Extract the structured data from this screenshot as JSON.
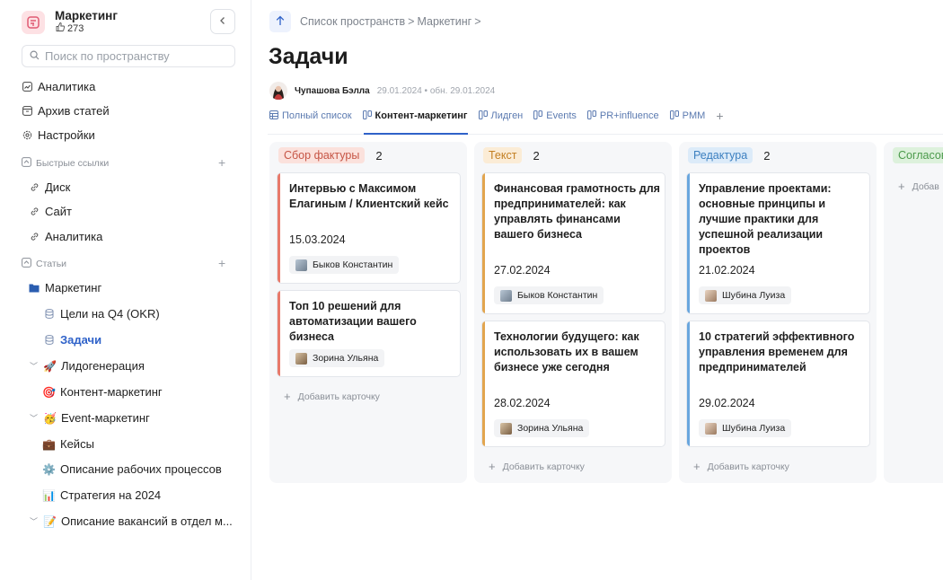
{
  "sidebar": {
    "space_name": "Маркетинг",
    "space_likes": "273",
    "search_placeholder": "Поиск по пространству",
    "top_items": [
      {
        "label": "Аналитика",
        "icon": "chart-icon"
      },
      {
        "label": "Архив статей",
        "icon": "archive-icon"
      },
      {
        "label": "Настройки",
        "icon": "gear-icon"
      }
    ],
    "quick_links_label": "Быстрые ссылки",
    "quick_links": [
      "Диск",
      "Сайт",
      "Аналитика"
    ],
    "articles_label": "Статьи",
    "tree": [
      {
        "label": "Маркетинг",
        "icon": "📁"
      },
      {
        "label": "Цели на Q4 (OKR)"
      },
      {
        "label": "Задачи"
      },
      {
        "label": "Лидогенерация",
        "icon": "🚀"
      },
      {
        "label": "Контент-маркетинг",
        "icon": "🎯"
      },
      {
        "label": "Event-маркетинг",
        "icon": "🥳"
      },
      {
        "label": "Кейсы",
        "icon": "💼"
      },
      {
        "label": "Описание рабочих процессов",
        "icon": "⚙️"
      },
      {
        "label": "Стратегия на 2024",
        "icon": "📊"
      },
      {
        "label": "Описание вакансий в отдел м...",
        "icon": "📝"
      }
    ]
  },
  "breadcrumb": {
    "spaces": "Список пространств",
    "sep1": ">",
    "space": "Маркетинг",
    "sep2": ">"
  },
  "page": {
    "title": "Задачи",
    "author": "Чупашова Бэлла",
    "meta": "29.01.2024 • обн. 29.01.2024"
  },
  "views": [
    {
      "label": "Полный список"
    },
    {
      "label": "Контент-маркетинг"
    },
    {
      "label": "Лидген"
    },
    {
      "label": "Events"
    },
    {
      "label": "PR+influence"
    },
    {
      "label": "PMM"
    }
  ],
  "board": {
    "add_card": "Добавить карточку",
    "columns": [
      {
        "label": "Сбор фактуры",
        "count": "2",
        "color": "#e8796a",
        "bg": "#fbe1dc",
        "fg": "#c65545",
        "cards": [
          {
            "title": "Интервью с Максимом Елагиным / Клиентский кейс",
            "date": "15.03.2024",
            "person": "Быков Константин"
          },
          {
            "title": "Топ 10 решений для автоматизации вашего бизнеса",
            "date": "",
            "person": "Зорина Ульяна"
          }
        ]
      },
      {
        "label": "Текст",
        "count": "2",
        "color": "#e2a54f",
        "bg": "#fbecd6",
        "fg": "#c37f22",
        "cards": [
          {
            "title": "Финансовая грамотность для предпринимателей: как управлять финансами вашего бизнеса",
            "date": "27.02.2024",
            "person": "Быков Константин"
          },
          {
            "title": "Технологии будущего: как использовать их в вашем бизнесе уже сегодня",
            "date": "28.02.2024",
            "person": "Зорина Ульяна"
          }
        ]
      },
      {
        "label": "Редактура",
        "count": "2",
        "color": "#69a6de",
        "bg": "#dcebf9",
        "fg": "#3b7fc0",
        "cards": [
          {
            "title": "Управление проектами: основные принципы и лучшие практики для успешной реализации проектов",
            "date": "21.02.2024",
            "person": "Шубина Луиза"
          },
          {
            "title": "10 стратегий эффективного управления временем для предпринимателей",
            "date": "29.02.2024",
            "person": "Шубина Луиза"
          }
        ]
      },
      {
        "label": "Согласов",
        "count": "",
        "color": "#8bc78b",
        "bg": "#ddf1dc",
        "fg": "#4b9a4b",
        "add_label": "Добав"
      }
    ]
  }
}
